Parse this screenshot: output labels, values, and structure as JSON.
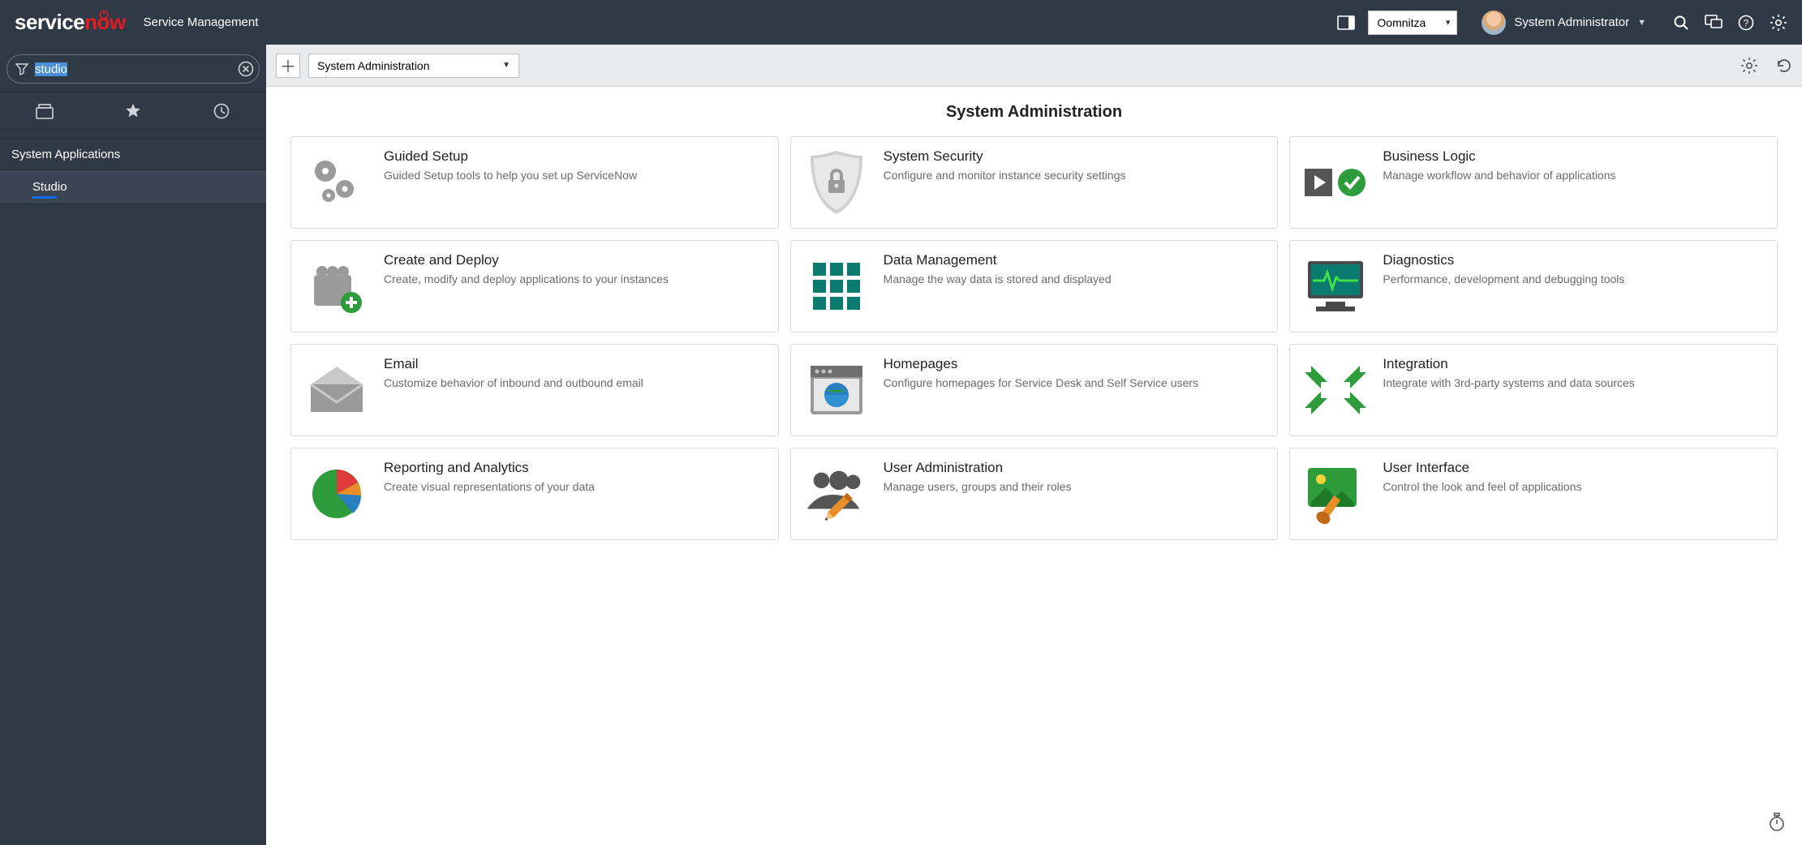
{
  "header": {
    "product_subtitle": "Service Management",
    "app_picker_value": "Oomnitza",
    "user_name": "System Administrator"
  },
  "sidebar": {
    "filter_value": "studio",
    "nav_group": "System Applications",
    "nav_item": "Studio"
  },
  "toolbar": {
    "scope_select_value": "System Administration"
  },
  "page": {
    "title": "System Administration"
  },
  "cards": [
    {
      "title": "Guided Setup",
      "desc": "Guided Setup tools to help you set up ServiceNow"
    },
    {
      "title": "System Security",
      "desc": "Configure and monitor instance security settings"
    },
    {
      "title": "Business Logic",
      "desc": "Manage workflow and behavior of applications"
    },
    {
      "title": "Create and Deploy",
      "desc": "Create, modify and deploy applications to your instances"
    },
    {
      "title": "Data Management",
      "desc": "Manage the way data is stored and displayed"
    },
    {
      "title": "Diagnostics",
      "desc": "Performance, development and debugging tools"
    },
    {
      "title": "Email",
      "desc": "Customize behavior of inbound and outbound email"
    },
    {
      "title": "Homepages",
      "desc": "Configure homepages for Service Desk and Self Service users"
    },
    {
      "title": "Integration",
      "desc": "Integrate with 3rd-party systems and data sources"
    },
    {
      "title": "Reporting and Analytics",
      "desc": "Create visual representations of your data"
    },
    {
      "title": "User Administration",
      "desc": "Manage users, groups and their roles"
    },
    {
      "title": "User Interface",
      "desc": "Control the look and feel of applications"
    }
  ]
}
